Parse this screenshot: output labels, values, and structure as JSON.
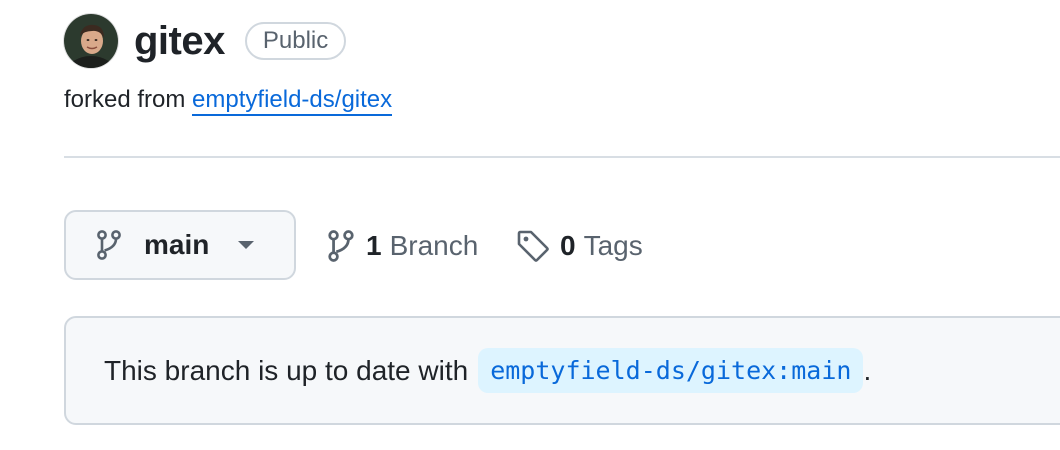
{
  "repo": {
    "name": "gitex",
    "visibility": "Public",
    "fork_prefix": "forked from",
    "fork_source": "emptyfield-ds/gitex"
  },
  "branch_selector": {
    "current": "main",
    "icon": "git-branch-icon",
    "caret_icon": "triangle-down-icon"
  },
  "branches": {
    "count": "1",
    "label": "Branch",
    "icon": "git-branch-icon"
  },
  "tags": {
    "count": "0",
    "label": "Tags",
    "icon": "tag-icon"
  },
  "status": {
    "text": "This branch is up to date with",
    "ref": "emptyfield-ds/gitex:main",
    "suffix": "."
  },
  "colors": {
    "link": "#0969da",
    "muted": "#59636e",
    "border": "#d0d7de",
    "panel_bg": "#f6f8fa",
    "ref_bg": "#ddf4ff"
  }
}
